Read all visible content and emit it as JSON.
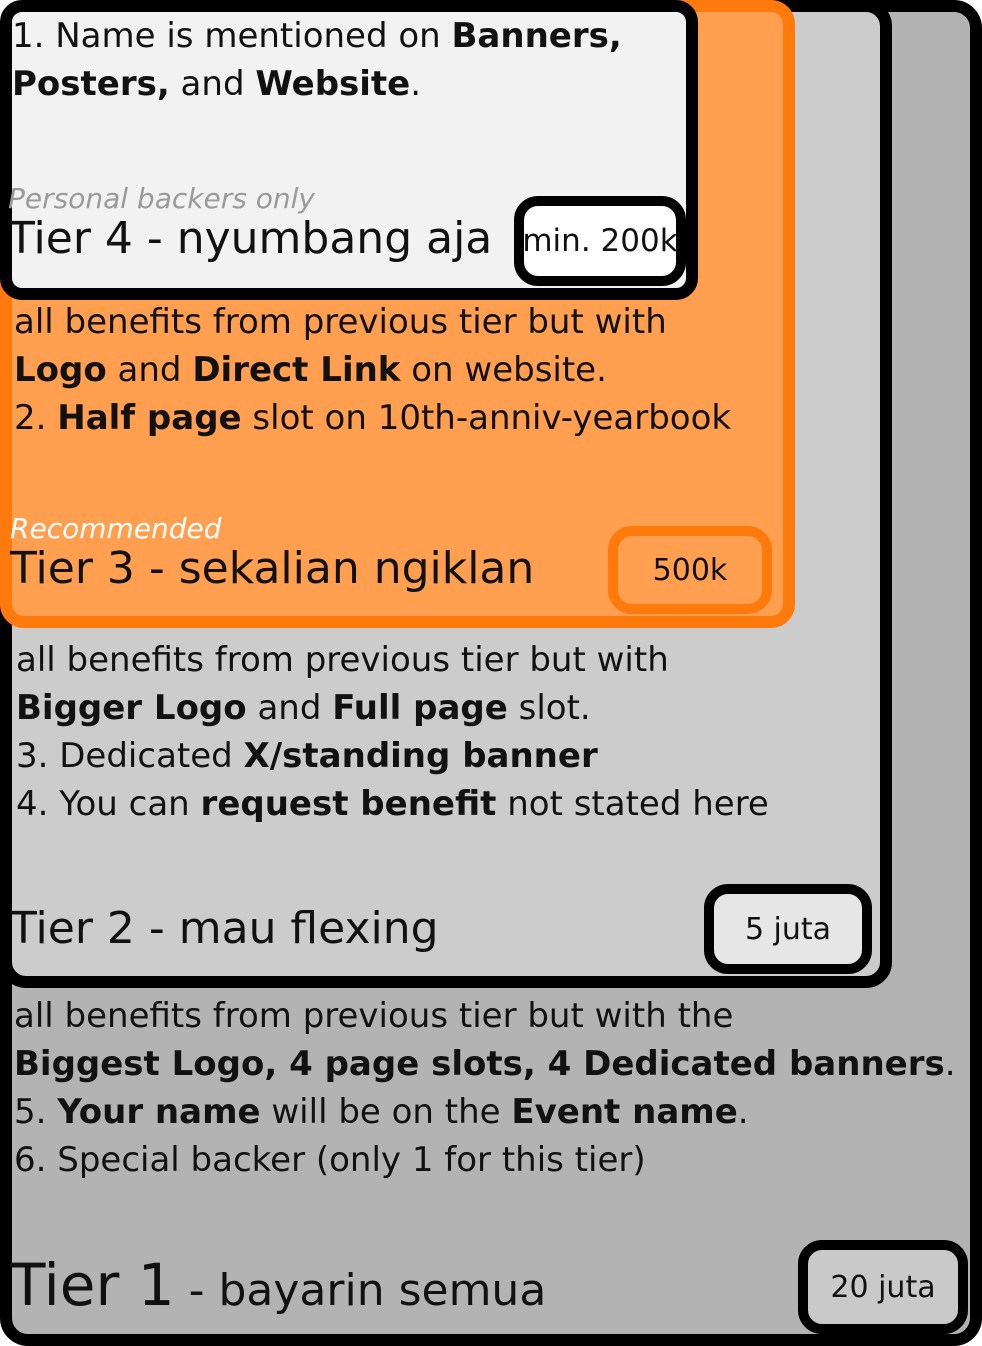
{
  "tiers": [
    {
      "title_main": "Tier 1",
      "title_rest": " - bayarin semua",
      "price": "20 juta",
      "benefits": {
        "l1": "all benefits from previous tier but with the",
        "l2_bold": "Biggest Logo, 4 page slots, 4 Dedicated banners",
        "l2_end": ".",
        "l3_pre": "5. ",
        "l3_b1": "Your name",
        "l3_mid": " will be on the ",
        "l3_b2": "Event name",
        "l3_end": ".",
        "l4": "6. Special backer (only 1 for this tier)"
      }
    },
    {
      "title": "Tier 2 - mau flexing",
      "price": "5 juta",
      "benefits": {
        "l1": "all benefits from previous tier but with",
        "l2_b1": "Bigger Logo",
        "l2_mid": " and ",
        "l2_b2": "Full page",
        "l2_end": " slot.",
        "l3_pre": "3. Dedicated ",
        "l3_bold": "X/standing banner",
        "l4_pre": "4. You can ",
        "l4_bold": "request benefit",
        "l4_end": " not stated here"
      }
    },
    {
      "title": "Tier 3 - sekalian ngiklan",
      "tag": "Recommended",
      "price": "500k",
      "benefits": {
        "l1": "all benefits from previous tier but with",
        "l2_b1": "Logo",
        "l2_mid": " and ",
        "l2_b2": "Direct Link",
        "l2_end": " on website.",
        "l3_pre": "2. ",
        "l3_bold": "Half page",
        "l3_end": " slot on 10th-anniv-yearbook"
      }
    },
    {
      "title": "Tier 4 - nyumbang aja",
      "tag": "Personal backers only",
      "price": "min. 200k",
      "benefits": {
        "l1_pre": "1. Name is mentioned on ",
        "l1_bold": "Banners,",
        "l2_bold": "Posters,",
        "l2_mid": " and ",
        "l2_bold2": "Website",
        "l2_end": "."
      }
    }
  ],
  "colors": {
    "tier1_bg": "#b3b3b3",
    "tier2_bg": "#cccccc",
    "tier3_bg": "#ff9f4f",
    "tier3_border": "#ff7a0d",
    "tier4_bg": "#f2f2f2",
    "border": "#000000"
  }
}
